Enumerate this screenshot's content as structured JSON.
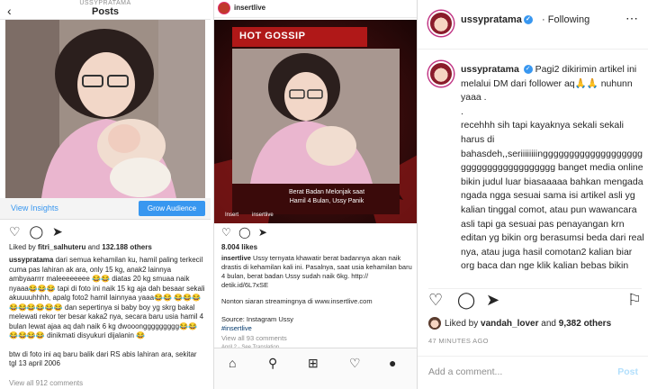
{
  "panel1": {
    "username": "USSYPRATAMA",
    "title": "Posts",
    "view_insights": "View Insights",
    "grow_audience": "Grow Audience",
    "liked_by_user": "fitri_salhuteru",
    "liked_by_others": "132.188 others",
    "liked_prefix": "Liked by",
    "liked_and": "and",
    "caption_user": "ussypratama",
    "caption_text": "dari semua kehamilan ku, hamil paling terkecil cuma pas lahiran ak ara, only 15 kg, anak2 lainnya ambyaarrrr maleeeeeeee 😂😂 diatas 20 kg smuaa naik nyaaa😂😂😂 tapi di foto ini naik 15 kg aja dah besaar sekali akuuuuhhhh, apalg foto2 hamil lainnyaa yaaa😂😂 😂😂😂😂😂😂😂😂😂 dan sepertinya si baby boy yg skrg bakal melewati rekor ter besar kaka2 nya, secara baru usia hamil 4 bulan lewat ajaa aq dah naik 6 kg dwooonggggggggg😂😂😂😂😂😂 dinikmati disyukuri dijalanin 😂",
    "caption_footer": "btw di foto ini aq baru balik dari RS abis lahiran ara, sekitar tgl 13 april 2006",
    "view_comments": "View all 912 comments"
  },
  "panel2": {
    "username": "insertlive",
    "hot_gossip": "HOT GOSSIP",
    "overlay_line1": "Berat Badan Melonjak saat",
    "overlay_line2": "Hamil 4 Bulan, Ussy Panik",
    "brand1": "Insert",
    "brand2": "insertlive",
    "views": "8.004 likes",
    "caption_user": "insertlive",
    "caption_text": "Ussy ternyata khawatir berat badannya akan naik drastis di kehamilan kali ini. Pasalnya, saat usia kehamilan baru 4 bulan, berat badan Ussy sudah naik 6kg.  http:// detik.id/6L7xSE",
    "line_nonton": "Nonton siaran streamingnya di www.insertlive.com",
    "line_source": "Source: Instagram Ussy",
    "line_hashtag": "#insertlive",
    "view_comments": "View all 93 comments",
    "see_translation": "April 2 · See Translation"
  },
  "panel3": {
    "username": "ussypratama",
    "following": "Following",
    "caption_user": "ussypratama",
    "caption_text": "Pagi2 dikirimin artikel ini melalui DM dari follower aq🙏🙏 nuhunn yaaa .\n.\nrecehhh sih tapi kayaknya sekali sekali harus di\nbahasdeh,,seriiiiiiiinggggggggggggggggggggggggggggggggggggg banget media online bikin judul luar biasaaaaa bahkan mengada ngada ngga sesuai sama isi artikel asli yg kalian tinggal comot, atau pun wawancara asli tapi ga sesuai pas penayangan krn editan yg bikin org berasumsi beda dari real nya, atau juga hasil comotan2 kalian biar org baca dan nge klik kalian bebas bikin",
    "liked_prefix": "Liked by",
    "liked_user": "vandah_lover",
    "liked_and": "and",
    "liked_others": "9,382 others",
    "time": "47 MINUTES AGO",
    "comment_placeholder": "Add a comment...",
    "post_label": "Post"
  }
}
